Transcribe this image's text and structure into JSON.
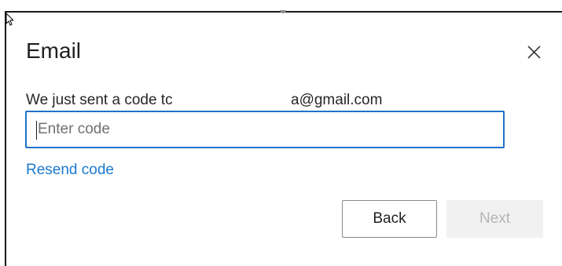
{
  "dialog": {
    "title": "Email",
    "message_prefix": "We just sent a code tc",
    "message_suffix": "a@gmail.com"
  },
  "code_input": {
    "placeholder": "Enter code",
    "value": ""
  },
  "links": {
    "resend": "Resend code"
  },
  "buttons": {
    "back": "Back",
    "next": "Next"
  },
  "icons": {
    "close": "close-icon",
    "cursor": "mouse-cursor-icon"
  },
  "colors": {
    "focus_border": "#1f73c8",
    "link": "#1c78cf",
    "disabled_bg": "#f1f1f1",
    "disabled_text": "#b5b5b5"
  }
}
